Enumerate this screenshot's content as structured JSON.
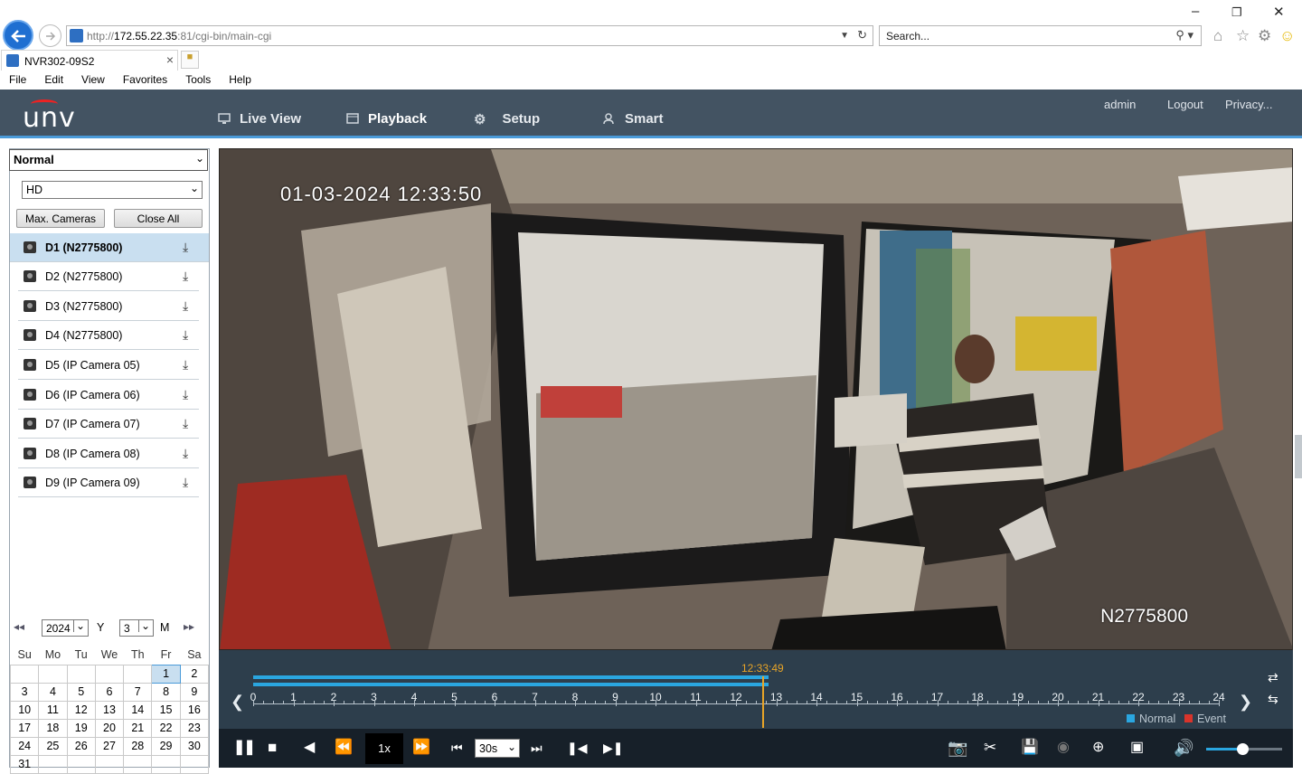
{
  "browser": {
    "url_prefix": "http://",
    "url_host": "172.55.22.35",
    "url_rest": ":81/cgi-bin/main-cgi",
    "search_placeholder": "Search...",
    "tab_title": "NVR302-09S2",
    "menu": [
      "File",
      "Edit",
      "View",
      "Favorites",
      "Tools",
      "Help"
    ]
  },
  "app": {
    "logo": "unv",
    "nav": [
      {
        "label": "Live View",
        "icon": "monitor-icon"
      },
      {
        "label": "Playback",
        "icon": "playback-icon",
        "active": true
      },
      {
        "label": "Setup",
        "icon": "gear-icon"
      },
      {
        "label": "Smart",
        "icon": "smart-icon"
      }
    ],
    "user": "admin",
    "logout": "Logout",
    "privacy": "Privacy..."
  },
  "sidebar": {
    "mode_select": "Normal",
    "stream_select": "HD",
    "max_cameras": "Max. Cameras",
    "close_all": "Close All",
    "cameras": [
      {
        "label": "D1 (N2775800)",
        "selected": true
      },
      {
        "label": "D2 (N2775800)"
      },
      {
        "label": "D3 (N2775800)"
      },
      {
        "label": "D4 (N2775800)"
      },
      {
        "label": "D5 (IP Camera 05)"
      },
      {
        "label": "D6 (IP Camera 06)"
      },
      {
        "label": "D7 (IP Camera 07)"
      },
      {
        "label": "D8 (IP Camera 08)"
      },
      {
        "label": "D9 (IP Camera 09)"
      }
    ],
    "calendar": {
      "year": "2024",
      "year_label": "Y",
      "month": "3",
      "month_label": "M",
      "weekdays": [
        "Su",
        "Mo",
        "Tu",
        "We",
        "Th",
        "Fr",
        "Sa"
      ],
      "weeks": [
        [
          "",
          "",
          "",
          "",
          "",
          "1",
          "2"
        ],
        [
          "3",
          "4",
          "5",
          "6",
          "7",
          "8",
          "9"
        ],
        [
          "10",
          "11",
          "12",
          "13",
          "14",
          "15",
          "16"
        ],
        [
          "17",
          "18",
          "19",
          "20",
          "21",
          "22",
          "23"
        ],
        [
          "24",
          "25",
          "26",
          "27",
          "28",
          "29",
          "30"
        ],
        [
          "31",
          "",
          "",
          "",
          "",
          "",
          ""
        ]
      ],
      "selected_day": "1"
    }
  },
  "video": {
    "osd_timestamp": "01-03-2024 12:33:50",
    "osd_camera": "N2775800"
  },
  "timeline": {
    "current_time": "12:33:49",
    "hours": [
      "0",
      "1",
      "2",
      "3",
      "4",
      "5",
      "6",
      "7",
      "8",
      "9",
      "10",
      "11",
      "12",
      "13",
      "14",
      "15",
      "16",
      "17",
      "18",
      "19",
      "20",
      "21",
      "22",
      "23",
      "24"
    ],
    "recorded_until_hour": 12.8,
    "legend_normal": "Normal",
    "legend_event": "Event",
    "colors": {
      "normal": "#2aa6e0",
      "event": "#d9342b",
      "cursor": "#e8a427"
    }
  },
  "controls": {
    "speed": "1x",
    "step": "30s"
  }
}
